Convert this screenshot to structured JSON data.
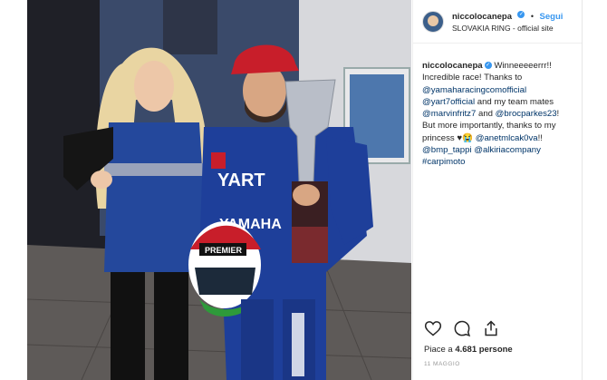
{
  "post": {
    "username": "niccolocanepa",
    "verified_mark": "✓",
    "separator": "•",
    "follow_label": "Segui",
    "location": "SLOVAKIA RING - official site"
  },
  "caption": {
    "username": "niccolocanepa",
    "line1": " Winneeeeerrr!! Incredible race! Thanks to ",
    "tag1": "@yamaharacingcomofficial",
    "line2": " ",
    "tag2": "@yart7official",
    "line3": " and my team mates ",
    "tag3": "@marvinfritz7",
    "line4": " and ",
    "tag4": "@brocparkes23",
    "line5": "! But more importantly, thanks to my princess ♥😭 ",
    "tag5": "@anetmlcak0va",
    "line6": "!! ",
    "tag6": "@bmp_tappi",
    "line7": " ",
    "tag7": "@alkiriacompany",
    "line8": " ",
    "tag8": "#carpimoto"
  },
  "likes": {
    "prefix": "Piace a ",
    "count": "4.681",
    "suffix": " persone"
  },
  "date": "11 MAGGIO",
  "photo": {
    "suit_text": "YART",
    "suit_brand": "YAMAHA",
    "helmet_text": "PREMIER",
    "colors": {
      "suit_blue": "#1e3f9a",
      "cap_red": "#c81e2a",
      "wall": "#cfd3da",
      "floor": "#5e5a58"
    }
  }
}
